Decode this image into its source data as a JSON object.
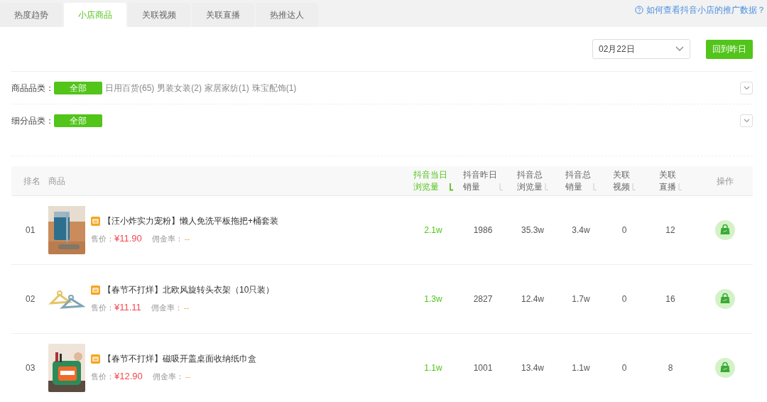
{
  "tabs": [
    {
      "label": "热度趋势",
      "selected": false
    },
    {
      "label": "小店商品",
      "selected": true
    },
    {
      "label": "关联视频",
      "selected": false
    },
    {
      "label": "关联直播",
      "selected": false
    },
    {
      "label": "热推达人",
      "selected": false
    }
  ],
  "help_link": "如何查看抖音小店的推广数据？",
  "date_select": {
    "value": "02月22日"
  },
  "back_button": "回到昨日",
  "filters": [
    {
      "label": "商品品类：",
      "options": [
        {
          "label": "全部",
          "selected": true
        },
        {
          "label": "日用百货(65)",
          "selected": false
        },
        {
          "label": "男装女装(2)",
          "selected": false
        },
        {
          "label": "家居家纺(1)",
          "selected": false
        },
        {
          "label": "珠宝配饰(1)",
          "selected": false
        }
      ]
    },
    {
      "label": "细分品类：",
      "options": [
        {
          "label": "全部",
          "selected": true
        }
      ]
    }
  ],
  "table": {
    "rank_column": "排名",
    "product_column": "商品",
    "metric_columns": [
      {
        "lines": [
          "抖音当日",
          "浏览量"
        ],
        "selected": true
      },
      {
        "lines": [
          "抖音昨日",
          "销量"
        ],
        "selected": false
      },
      {
        "lines": [
          "抖音总",
          "浏览量"
        ],
        "selected": false
      },
      {
        "lines": [
          "抖音总",
          "销量"
        ],
        "selected": false
      },
      {
        "lines": [
          "关联",
          "视频"
        ],
        "selected": false
      },
      {
        "lines": [
          "关联",
          "直播"
        ],
        "selected": false
      }
    ],
    "action_column": "操作",
    "rows": [
      {
        "rank": "01",
        "title": "【汪小炸实力宠粉】懒人免洗平板拖把+桶套装",
        "price_label": "售价：",
        "price": "¥11.90",
        "commission_label": "佣金率：",
        "commission": "--",
        "metrics": [
          "2.1w",
          "1986",
          "35.3w",
          "3.4w",
          "0",
          "12"
        ]
      },
      {
        "rank": "02",
        "title": "【春节不打烊】北欧风旋转头衣架（10只装）",
        "price_label": "售价：",
        "price": "¥11.11",
        "commission_label": "佣金率：",
        "commission": "--",
        "metrics": [
          "1.3w",
          "2827",
          "12.4w",
          "1.7w",
          "0",
          "16"
        ]
      },
      {
        "rank": "03",
        "title": "【春节不打烊】磁吸开盖桌面收纳纸巾盒",
        "price_label": "售价：",
        "price": "¥12.90",
        "commission_label": "佣金率：",
        "commission": "--",
        "metrics": [
          "1.1w",
          "1001",
          "13.4w",
          "1.1w",
          "0",
          "8"
        ]
      }
    ]
  }
}
